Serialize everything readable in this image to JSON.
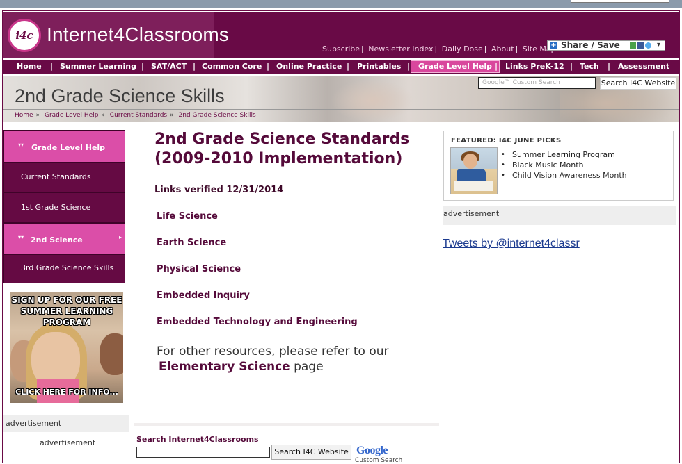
{
  "site": {
    "logo_short": "i4c",
    "logo_text": "Internet4Classrooms"
  },
  "top_links": [
    "Subscribe",
    "Newsletter Index",
    "Daily Dose",
    "About",
    "Site Map"
  ],
  "share": {
    "label": "Share / Save"
  },
  "nav": [
    {
      "label": "Home"
    },
    {
      "label": "Summer Learning"
    },
    {
      "label": "SAT/ACT"
    },
    {
      "label": "Common Core"
    },
    {
      "label": "Online Practice"
    },
    {
      "label": "Printables"
    },
    {
      "label": "Grade Level Help"
    },
    {
      "label": "Links PreK-12"
    },
    {
      "label": "Tech"
    },
    {
      "label": "Assessment"
    }
  ],
  "banner": {
    "title": "2nd Grade Science Skills",
    "breadcrumb": [
      "Home",
      "Grade Level Help",
      "Current Standards",
      "2nd Grade Science Skills"
    ],
    "search_placeholder": "Google™ Custom Search",
    "search_button": "Search I4C Website"
  },
  "sidebar": {
    "items": [
      {
        "label": "Grade Level Help"
      },
      {
        "label": "Current Standards"
      },
      {
        "label": "1st Grade Science"
      },
      {
        "label": "2nd Science"
      },
      {
        "label": "3rd Grade Science Skills"
      }
    ],
    "promo_headline": "SIGN UP FOR OUR FREE SUMMER LEARNING PROGRAM",
    "promo_cta": "CLICK HERE FOR INFO...",
    "ad_label": "advertisement",
    "ad_text": "advertisement"
  },
  "main": {
    "title": "2nd Grade Science Standards (2009-2010 Implementation)",
    "verified": "Links verified 12/31/2014",
    "links": [
      "Life Science",
      "Earth Science",
      "Physical Science",
      "Embedded Inquiry",
      "Embedded Technology and Engineering"
    ],
    "other_prefix": "For other resources, please refer to our",
    "other_link": "Elementary Science",
    "other_suffix": "page",
    "search_label": "Search Internet4Classrooms",
    "search_button": "Search I4C Website",
    "google_logo": "Google",
    "google_sub": "Custom Search"
  },
  "featured": {
    "heading": "FEATURED: I4C JUNE PICKS",
    "items": [
      "Summer Learning Program",
      "Black Music Month",
      "Child Vision Awareness Month"
    ]
  },
  "right": {
    "ad_label": "advertisement",
    "tweets": "Tweets by @internet4classr"
  },
  "colors": {
    "brand": "#690a46",
    "accent_pink": "#d9479d",
    "link": "#550a3a",
    "tweet_link": "#1b3a8f"
  }
}
